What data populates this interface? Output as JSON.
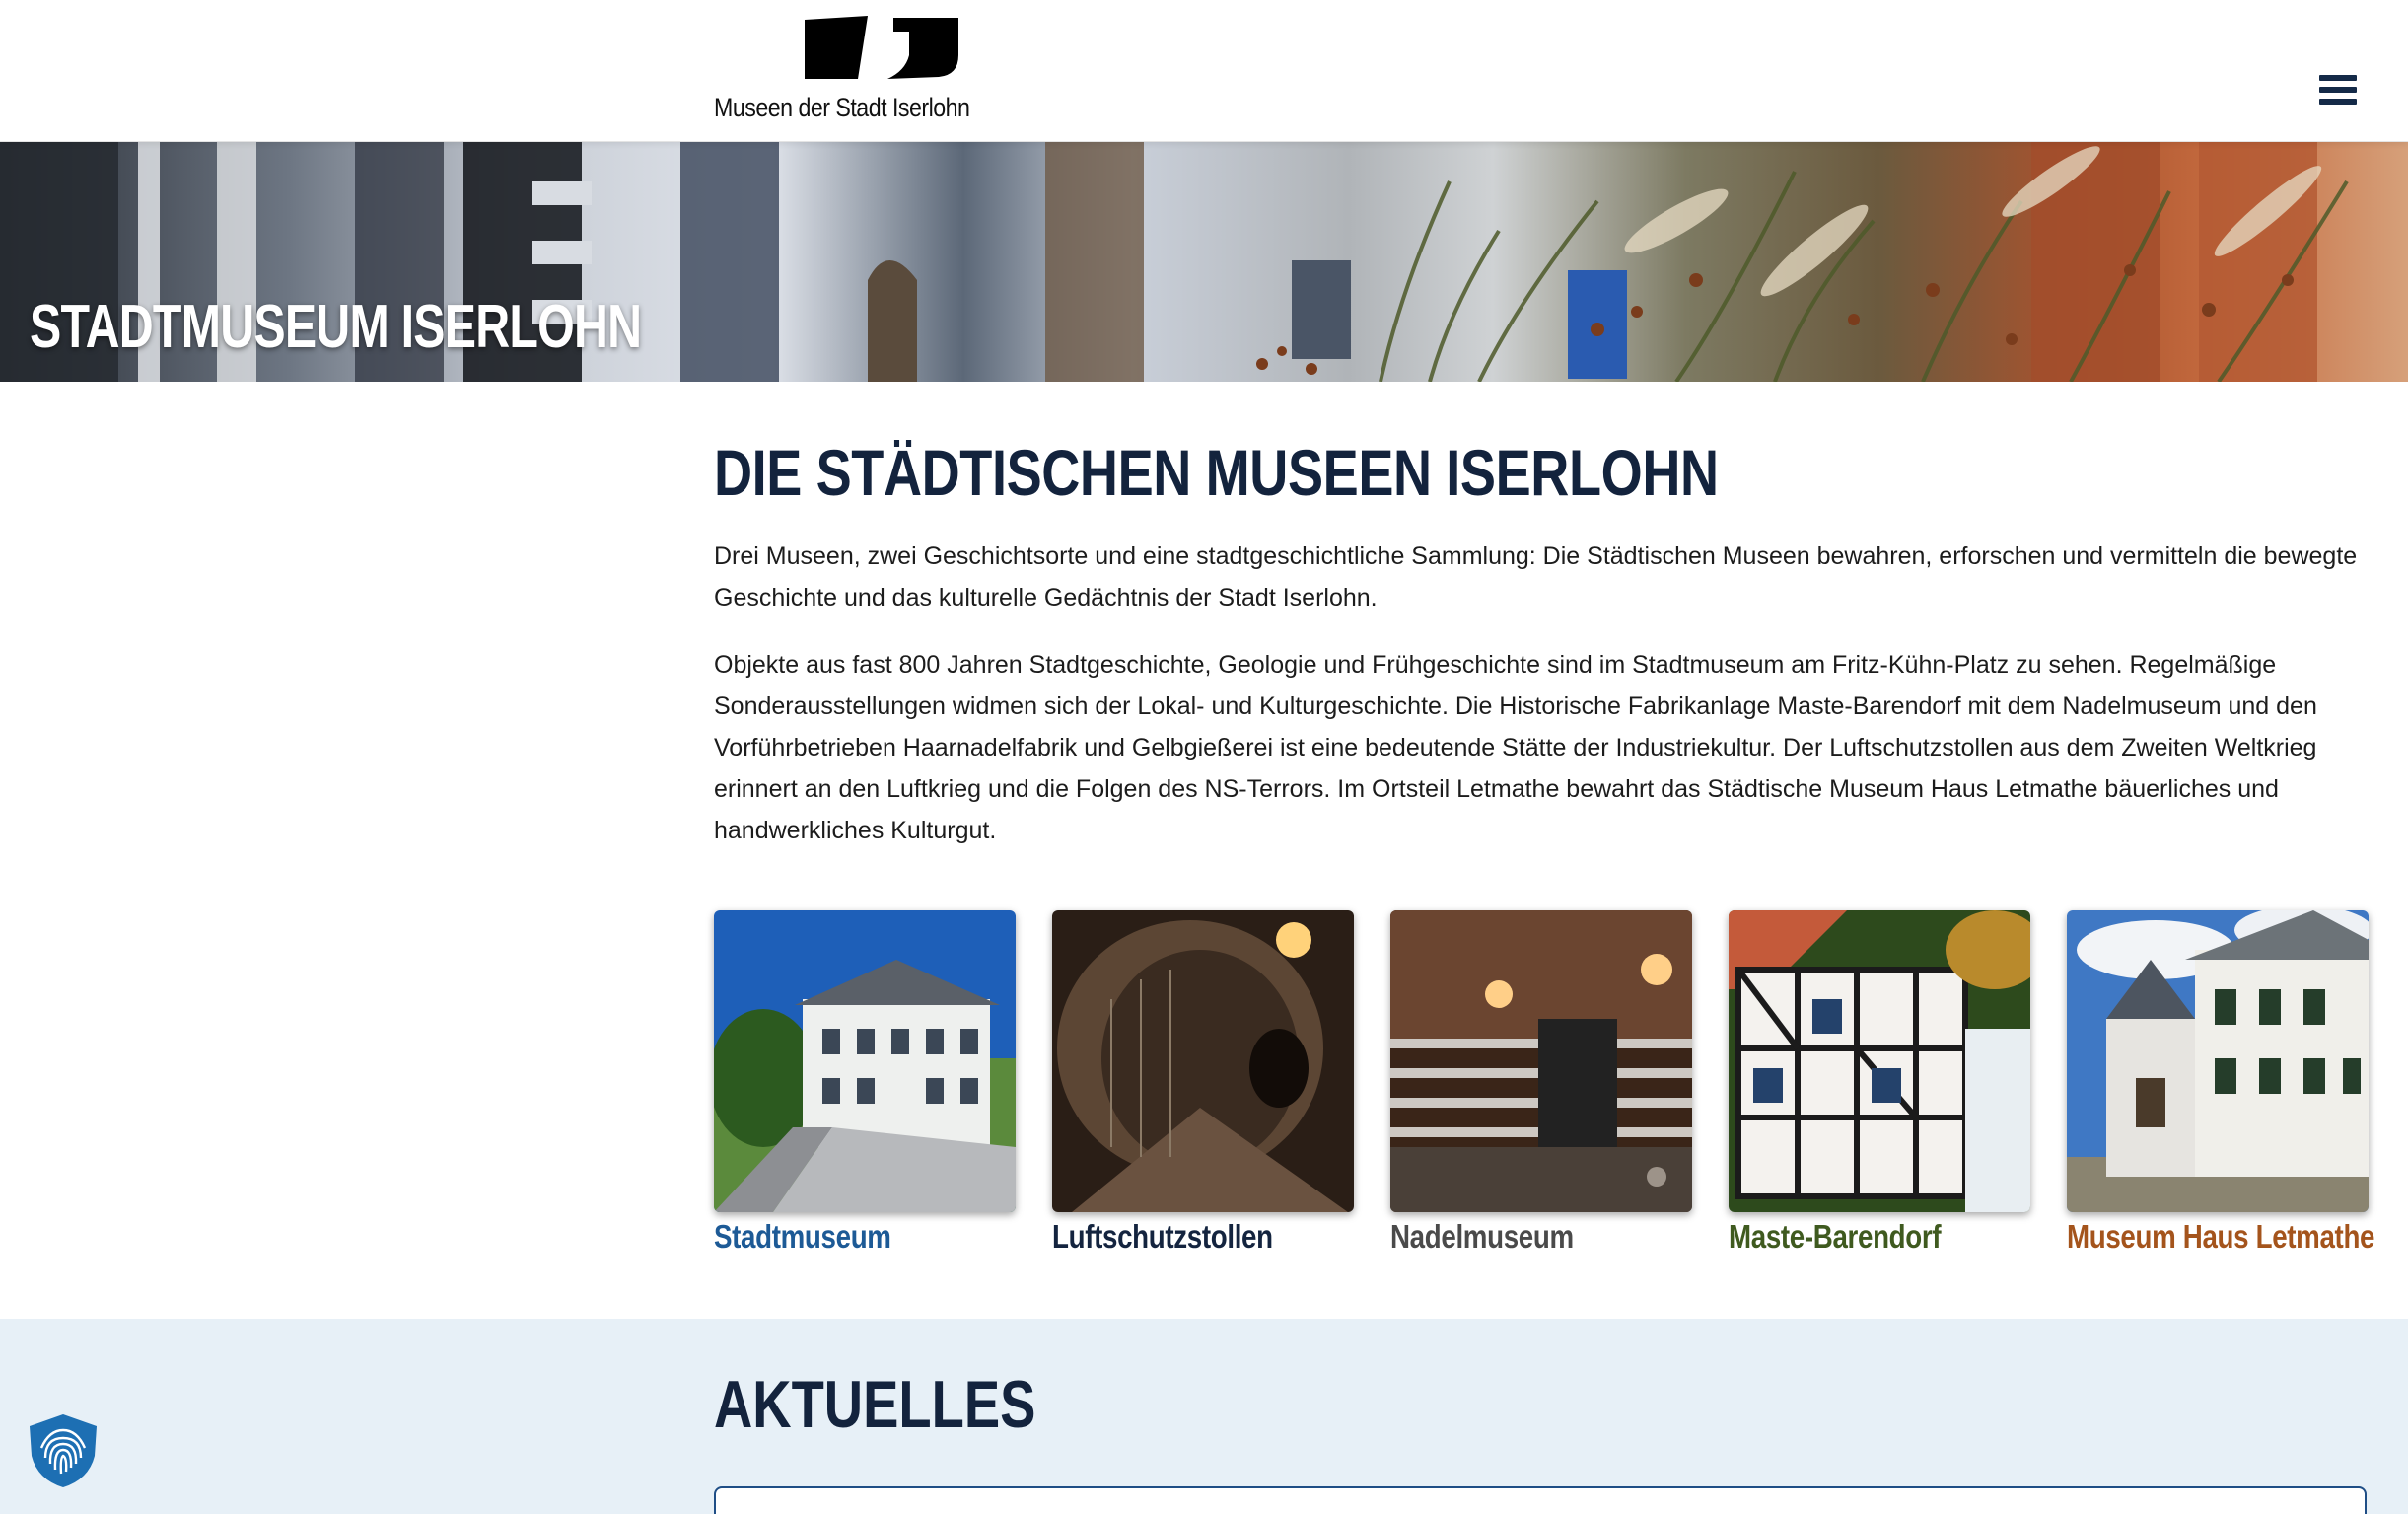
{
  "header": {
    "logo_text": "Museen der Stadt Iserlohn",
    "menu_icon": "hamburger-menu-icon"
  },
  "hero": {
    "title": "STADTMUSEUM ISERLOHN"
  },
  "main": {
    "title": "DIE STÄDTISCHEN MUSEEN ISERLOHN",
    "intro": "Drei Museen, zwei Geschichtsorte und eine stadtgeschichtliche Sammlung: Die Städtischen Museen bewahren, erforschen und vermitteln die bewegte Geschichte und das kulturelle Gedächtnis der Stadt Iserlohn.",
    "description": "Objekte aus fast 800 Jahren Stadtgeschichte, Geologie und Frühgeschichte sind im Stadtmuseum am Fritz-Kühn-Platz zu sehen. Regelmäßige Sonderausstellungen widmen sich der Lokal- und Kulturgeschichte. Die Historische Fabrikanlage Maste-Barendorf mit dem Nadelmuseum und den Vorführbetrieben Haarnadelfabrik und Gelbgießerei ist eine bedeutende Stätte der Industriekultur. Der Luftschutzstollen aus dem Zweiten Weltkrieg erinnert an den Luftkrieg und die Folgen des NS-Terrors. Im Ortsteil Letmathe bewahrt das Städtische Museum Haus Letmathe bäuerliches und handwerkliches Kulturgut."
  },
  "museums": [
    {
      "name": "Stadtmuseum",
      "color": "#1d5a96"
    },
    {
      "name": "Luftschutzstollen",
      "color": "#14243f"
    },
    {
      "name": "Nadelmuseum",
      "color": "#4a4a4a"
    },
    {
      "name": "Maste-Barendorf",
      "color": "#3f5a1f"
    },
    {
      "name": "Museum Haus Letmathe",
      "color": "#a4541c"
    }
  ],
  "news": {
    "title": "AKTUELLES"
  },
  "privacy": {
    "icon": "fingerprint-shield-icon",
    "color": "#1d6fb3"
  }
}
